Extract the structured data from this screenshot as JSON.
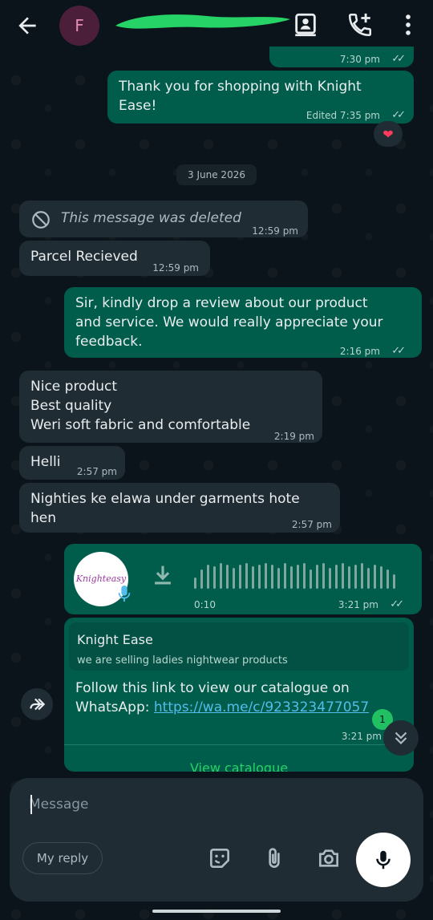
{
  "header": {
    "avatar_letter": "F"
  },
  "messages": {
    "top_partial_time": "7:30 pm",
    "thankyou_text": "Thank you for shopping with Knight Ease!",
    "thankyou_time": "Edited 7:35 pm",
    "reaction": "❤",
    "date": "3 June 2026",
    "deleted_text": "This message was deleted",
    "deleted_time": "12:59 pm",
    "parcel_text": "Parcel Recieved",
    "parcel_time": "12:59 pm",
    "review_text": "Sir, kindly drop a review about our product and service. We would really appreciate your feedback.",
    "review_time": "2:16 pm",
    "nice_line1": "Nice product",
    "nice_line2": "Best quality",
    "nice_line3": "Weri soft fabric and comfortable",
    "nice_time": "2:19 pm",
    "helli_text": "Helli",
    "helli_time": "2:57 pm",
    "nighties_text": "Nighties ke elawa under  garments hote hen",
    "nighties_time": "2:57 pm",
    "voice_logo": "Knighteasy",
    "voice_duration": "0:10",
    "voice_time": "3:21 pm",
    "catalog_name": "Knight Ease",
    "catalog_desc": "we are selling ladies nightwear products",
    "catalog_text": "Follow this link to view our catalogue on WhatsApp:",
    "catalog_link": "https://wa.me/c/923323477057",
    "catalog_time": "3:21 pm",
    "view_catalog": "View catalogue",
    "unread_count": "1"
  },
  "composer": {
    "placeholder": "Message",
    "reply_chip": "My reply"
  }
}
